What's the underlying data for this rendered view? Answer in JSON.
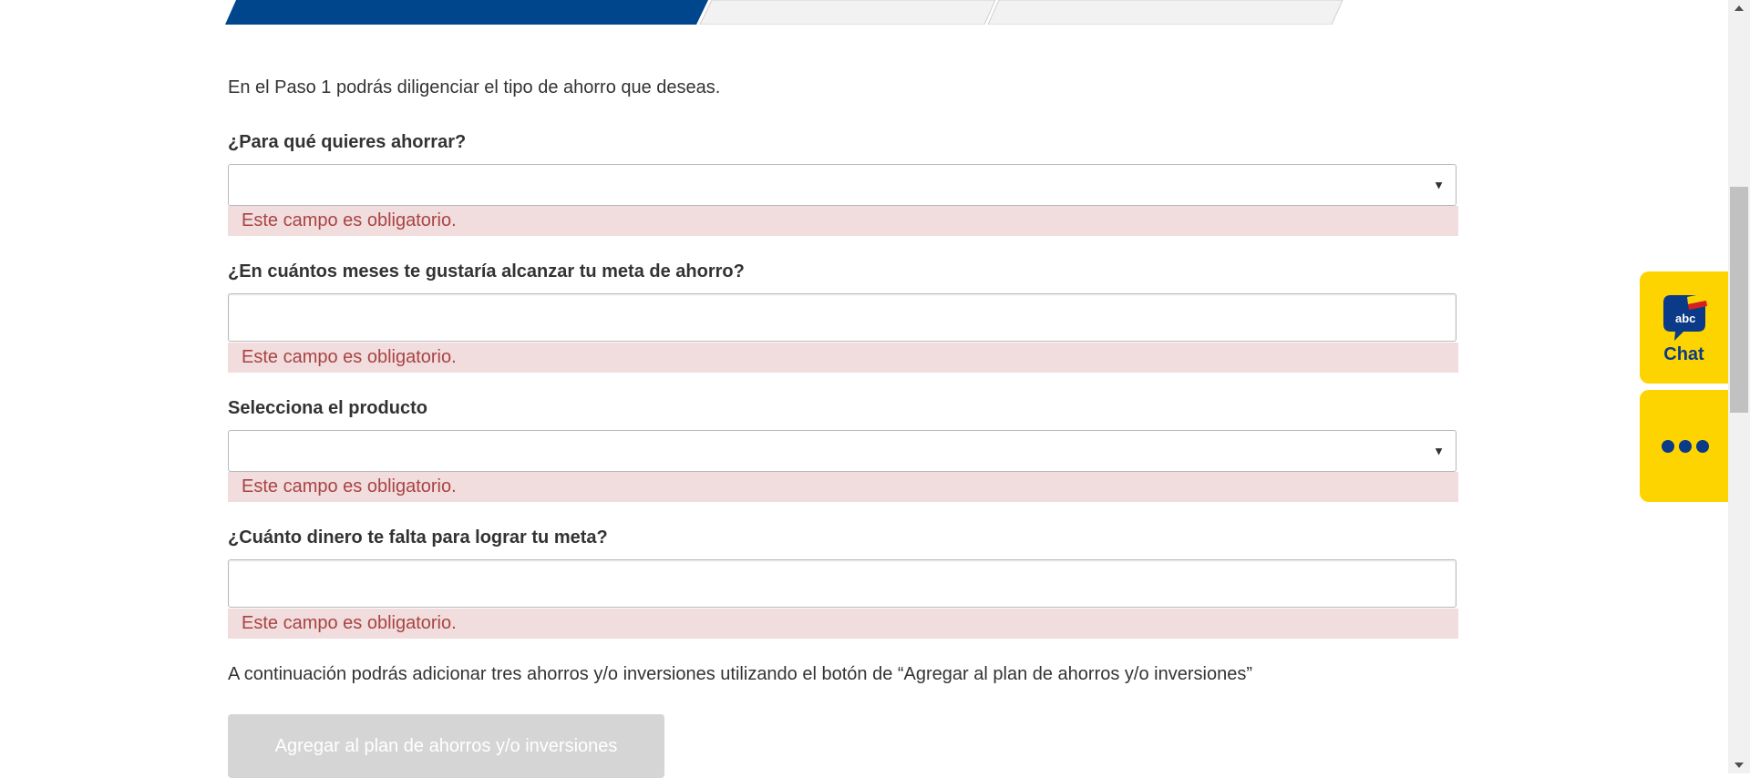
{
  "intro": "En el Paso 1 podrás diligenciar el tipo de ahorro que deseas.",
  "fields": [
    {
      "label": "¿Para qué quieres ahorrar?",
      "type": "select",
      "value": "",
      "error": "Este campo es obligatorio."
    },
    {
      "label": "¿En cuántos meses te gustaría alcanzar tu meta de ahorro?",
      "type": "input",
      "value": "",
      "error": "Este campo es obligatorio."
    },
    {
      "label": "Selecciona el producto",
      "type": "select",
      "value": "",
      "error": "Este campo es obligatorio."
    },
    {
      "label": "¿Cuánto dinero te falta para lograr tu meta?",
      "type": "input",
      "value": "",
      "error": "Este campo es obligatorio."
    }
  ],
  "note": "A continuación podrás adicionar tres ahorros y/o inversiones utilizando el botón de “Agregar al plan de ahorros y/o inversiones”",
  "add_button_label": "Agregar al plan de ahorros y/o inversiones",
  "chat_widget": {
    "label": "Chat",
    "icon": "chat-bubble-icon",
    "badge": "abc"
  },
  "more_widget": {
    "icon": "more-dots-icon"
  },
  "colors": {
    "step_active": "#00468c",
    "step_inactive": "#f2f2f2",
    "error_bg": "#f1dcde",
    "error_text": "#a94442",
    "widget_yellow": "#fdd300",
    "widget_blue": "#0a3a88",
    "button_disabled": "#d5d5d5"
  }
}
